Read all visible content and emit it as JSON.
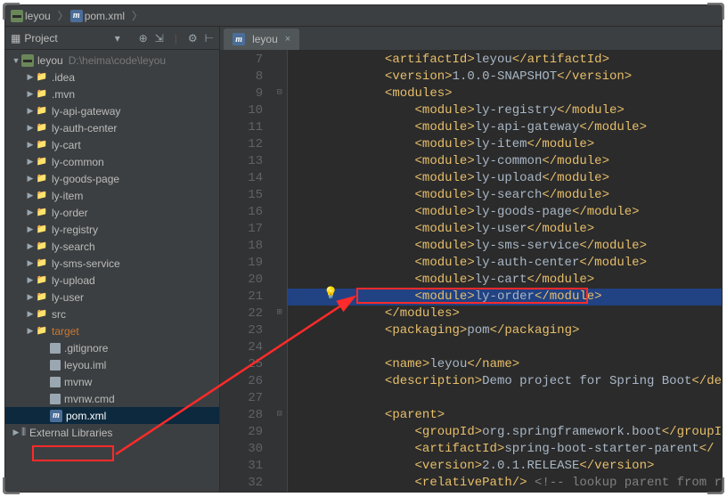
{
  "crumbs": {
    "root": "leyou",
    "file": "pom.xml"
  },
  "project": {
    "title": "Project"
  },
  "tree": {
    "root": "leyou",
    "root_hint": "D:\\heima\\code\\leyou",
    "items": [
      {
        "label": ".idea",
        "kind": "folder"
      },
      {
        "label": ".mvn",
        "kind": "folder"
      },
      {
        "label": "ly-api-gateway",
        "kind": "module"
      },
      {
        "label": "ly-auth-center",
        "kind": "module"
      },
      {
        "label": "ly-cart",
        "kind": "module"
      },
      {
        "label": "ly-common",
        "kind": "module"
      },
      {
        "label": "ly-goods-page",
        "kind": "module"
      },
      {
        "label": "ly-item",
        "kind": "module"
      },
      {
        "label": "ly-order",
        "kind": "module"
      },
      {
        "label": "ly-registry",
        "kind": "module"
      },
      {
        "label": "ly-search",
        "kind": "module"
      },
      {
        "label": "ly-sms-service",
        "kind": "module"
      },
      {
        "label": "ly-upload",
        "kind": "module"
      },
      {
        "label": "ly-user",
        "kind": "module"
      },
      {
        "label": "src",
        "kind": "folder-grey"
      },
      {
        "label": "target",
        "kind": "folder-orange"
      },
      {
        "label": ".gitignore",
        "kind": "file"
      },
      {
        "label": "leyou.iml",
        "kind": "file"
      },
      {
        "label": "mvnw",
        "kind": "file"
      },
      {
        "label": "mvnw.cmd",
        "kind": "file"
      },
      {
        "label": "pom.xml",
        "kind": "pom",
        "selected": true
      }
    ],
    "ext_lib": "External Libraries"
  },
  "tab": {
    "label": "leyou"
  },
  "code": {
    "start": 7,
    "lines": [
      {
        "i": 12,
        "h": "<span class='tag'>&lt;artifactId&gt;</span>leyou<span class='tag'>&lt;/artifactId&gt;</span>"
      },
      {
        "i": 12,
        "h": "<span class='tag'>&lt;version&gt;</span>1.0.0-SNAPSHOT<span class='tag'>&lt;/version&gt;</span>"
      },
      {
        "i": 12,
        "fold": "-",
        "h": "<span class='tag'>&lt;modules&gt;</span>"
      },
      {
        "i": 16,
        "h": "<span class='tag'>&lt;module&gt;</span>ly-registry<span class='tag'>&lt;/module&gt;</span>"
      },
      {
        "i": 16,
        "h": "<span class='tag'>&lt;module&gt;</span>ly-api-gateway<span class='tag'>&lt;/module&gt;</span>"
      },
      {
        "i": 16,
        "h": "<span class='tag'>&lt;module&gt;</span>ly-item<span class='tag'>&lt;/module&gt;</span>"
      },
      {
        "i": 16,
        "h": "<span class='tag'>&lt;module&gt;</span>ly-common<span class='tag'>&lt;/module&gt;</span>"
      },
      {
        "i": 16,
        "h": "<span class='tag'>&lt;module&gt;</span>ly-upload<span class='tag'>&lt;/module&gt;</span>"
      },
      {
        "i": 16,
        "h": "<span class='tag'>&lt;module&gt;</span>ly-search<span class='tag'>&lt;/module&gt;</span>"
      },
      {
        "i": 16,
        "h": "<span class='tag'>&lt;module&gt;</span>ly-goods-page<span class='tag'>&lt;/module&gt;</span>"
      },
      {
        "i": 16,
        "h": "<span class='tag'>&lt;module&gt;</span>ly-user<span class='tag'>&lt;/module&gt;</span>"
      },
      {
        "i": 16,
        "h": "<span class='tag'>&lt;module&gt;</span>ly-sms-service<span class='tag'>&lt;/module&gt;</span>"
      },
      {
        "i": 16,
        "h": "<span class='tag'>&lt;module&gt;</span>ly-auth-center<span class='tag'>&lt;/module&gt;</span>"
      },
      {
        "i": 16,
        "h": "<span class='tag'>&lt;module&gt;</span>ly-cart<span class='tag'>&lt;/module&gt;</span>"
      },
      {
        "i": 16,
        "hl": true,
        "h": "<span class='tag'>&lt;module&gt;</span>ly-order<span class='tag'>&lt;/module&gt;</span>"
      },
      {
        "i": 12,
        "fold": "^",
        "h": "<span class='tag'>&lt;/modules&gt;</span>"
      },
      {
        "i": 12,
        "h": "<span class='tag'>&lt;packaging&gt;</span>pom<span class='tag'>&lt;/packaging&gt;</span>"
      },
      {
        "i": 0,
        "h": ""
      },
      {
        "i": 12,
        "h": "<span class='tag'>&lt;name&gt;</span>leyou<span class='tag'>&lt;/name&gt;</span>"
      },
      {
        "i": 12,
        "h": "<span class='tag'>&lt;description&gt;</span>Demo project for Spring Boot<span class='tag'>&lt;/de</span>"
      },
      {
        "i": 0,
        "h": ""
      },
      {
        "i": 12,
        "fold": "-",
        "h": "<span class='tag'>&lt;parent&gt;</span>"
      },
      {
        "i": 16,
        "h": "<span class='tag'>&lt;groupId&gt;</span>org.springframework.boot<span class='tag'>&lt;/groupI</span>"
      },
      {
        "i": 16,
        "h": "<span class='tag'>&lt;artifactId&gt;</span>spring-boot-starter-parent<span class='tag'>&lt;/</span>"
      },
      {
        "i": 16,
        "h": "<span class='tag'>&lt;version&gt;</span>2.0.1.RELEASE<span class='tag'>&lt;/version&gt;</span>"
      },
      {
        "i": 16,
        "h": "<span class='tag'>&lt;relativePath/&gt;</span> <span style='color:#808080'>&lt;!-- lookup parent from r</span>"
      }
    ]
  }
}
